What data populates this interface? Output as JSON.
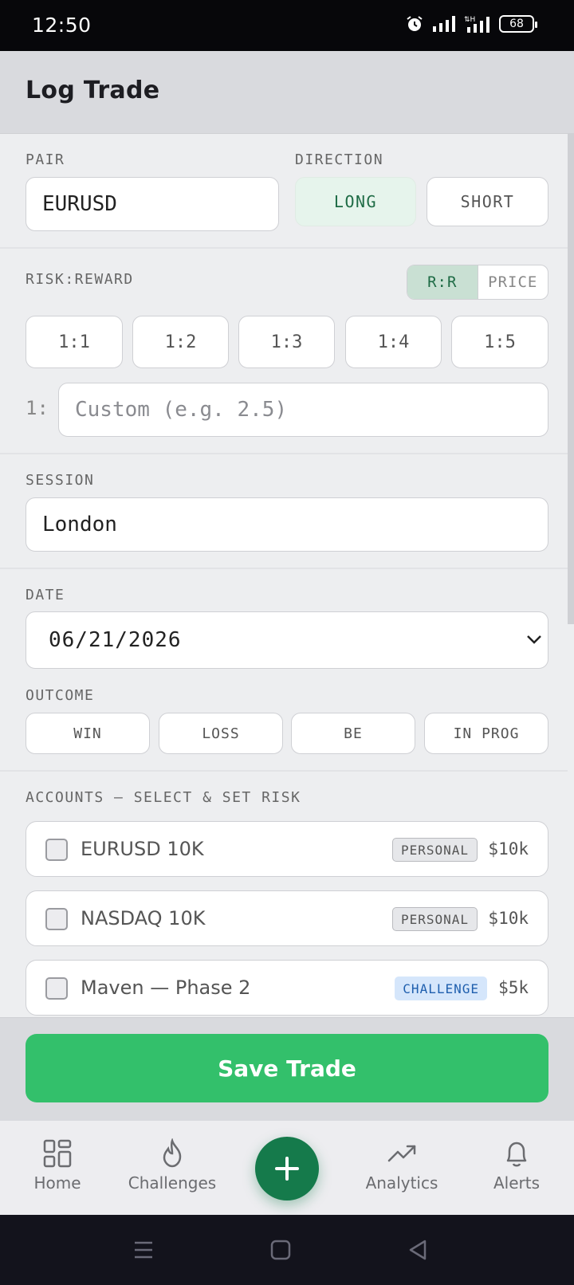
{
  "status_bar": {
    "time": "12:50",
    "battery": "68"
  },
  "header": {
    "title": "Log Trade"
  },
  "pair": {
    "label": "PAIR",
    "value": "EURUSD"
  },
  "direction": {
    "label": "DIRECTION",
    "long": "LONG",
    "short": "SHORT"
  },
  "risk_reward": {
    "label": "RISK:REWARD",
    "mode_rr": "R:R",
    "mode_price": "PRICE",
    "presets": [
      "1:1",
      "1:2",
      "1:3",
      "1:4",
      "1:5"
    ],
    "custom_prefix": "1:",
    "custom_placeholder": "Custom (e.g. 2.5)"
  },
  "session": {
    "label": "SESSION",
    "value": "London"
  },
  "date": {
    "label": "DATE",
    "value": "06/21/2026"
  },
  "outcome": {
    "label": "OUTCOME",
    "options": [
      "WIN",
      "LOSS",
      "BE",
      "IN PROG"
    ]
  },
  "accounts": {
    "label": "ACCOUNTS — SELECT & SET RISK",
    "items": [
      {
        "name": "EURUSD 10K",
        "tag": "PERSONAL",
        "amount": "$10k"
      },
      {
        "name": "NASDAQ 10K",
        "tag": "PERSONAL",
        "amount": "$10k"
      },
      {
        "name": "Maven — Phase 2",
        "tag": "CHALLENGE",
        "amount": "$5k"
      }
    ]
  },
  "save_button": "Save Trade",
  "tabs": {
    "home": "Home",
    "challenges": "Challenges",
    "analytics": "Analytics",
    "alerts": "Alerts"
  },
  "colors": {
    "accent_green": "#33c06b",
    "fab_green": "#157a4b",
    "long_active_bg": "#e6f4ec",
    "challenge_tag_bg": "#d5e6fb"
  }
}
